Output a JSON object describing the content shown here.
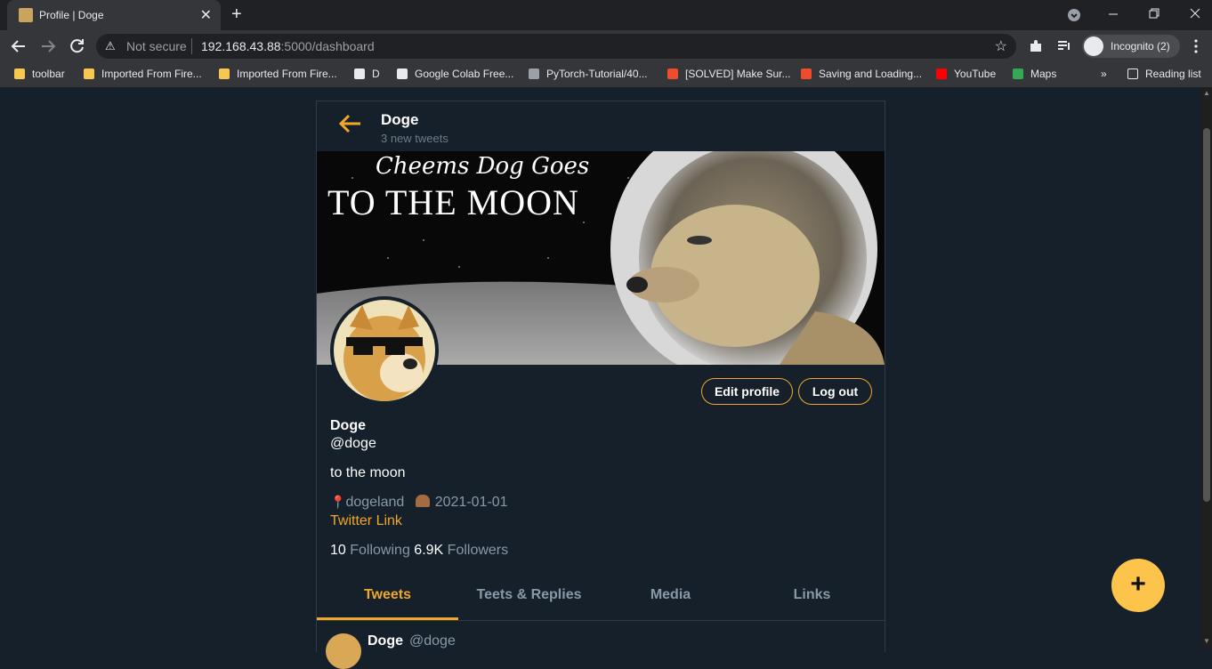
{
  "browser": {
    "tab_title": "Profile | Doge",
    "tab_close": "✕",
    "new_tab": "+",
    "not_secure": "Not secure",
    "url_host": "192.168.43.88",
    "url_rest": ":5000/dashboard",
    "incognito_label": "Incognito (2)",
    "bookmarks": [
      {
        "label": "toolbar",
        "color": "#f6c851"
      },
      {
        "label": "Imported From Fire...",
        "color": "#f6c851"
      },
      {
        "label": "Imported From Fire...",
        "color": "#f6c851"
      },
      {
        "label": "D",
        "color": "#e8eaed"
      },
      {
        "label": "Google Colab Free...",
        "color": "#e8eaed"
      },
      {
        "label": "PyTorch-Tutorial/40...",
        "color": "#9aa0a6"
      },
      {
        "label": "[SOLVED] Make Sur...",
        "color": "#ee4c2c"
      },
      {
        "label": "Saving and Loading...",
        "color": "#ee4c2c"
      },
      {
        "label": "YouTube",
        "color": "#ff0000"
      },
      {
        "label": "Maps",
        "color": "#34a853"
      }
    ],
    "more_bookmarks": "»",
    "reading_list": "Reading list"
  },
  "header": {
    "name": "Doge",
    "subtitle": "3 new tweets"
  },
  "banner": {
    "line1": "Cheems Dog Goes",
    "line2": "TO THE MOON"
  },
  "profile": {
    "edit_label": "Edit profile",
    "logout_label": "Log out",
    "name": "Doge",
    "handle": "@doge",
    "bio": "to the moon",
    "location": "dogeland",
    "joined": "2021-01-01",
    "link_text": "Twitter Link",
    "following_count": "10",
    "following_label": "Following",
    "followers_count": "6.9K",
    "followers_label": "Followers"
  },
  "tabs": [
    "Tweets",
    "Teets & Replies",
    "Media",
    "Links"
  ],
  "tweet": {
    "name": "Doge",
    "handle": "@doge"
  },
  "fab_label": "+",
  "colors": {
    "accent": "#f1a829",
    "background": "#15202b",
    "fab": "#fcc44a"
  }
}
